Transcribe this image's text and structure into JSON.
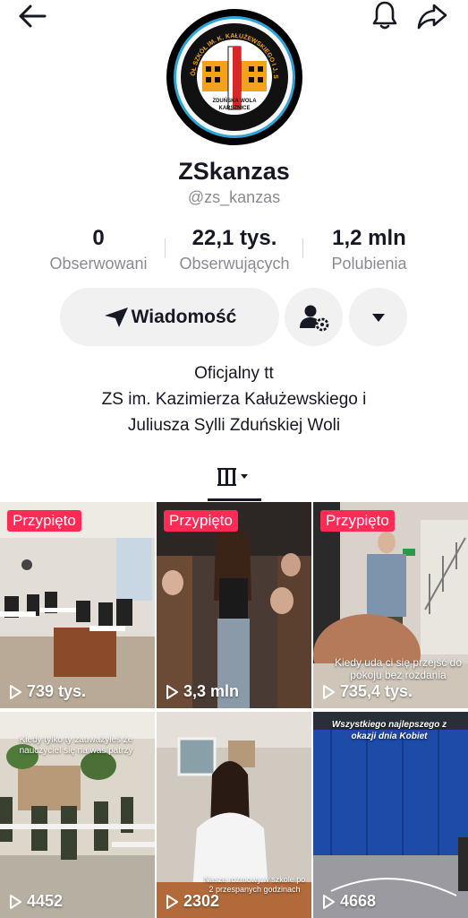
{
  "header": {
    "back_icon": "arrow-left-icon",
    "bell_icon": "bell-icon",
    "share_icon": "share-arrow-icon"
  },
  "profile": {
    "logo_text_top": "ZESPÓŁ SZKÓŁ IM. K. KAŁUŻEWSKIEGO I J. SYLLI",
    "logo_text_bottom_1": "ZDUŃSKA WOLA",
    "logo_text_bottom_2": "KARSZNICE",
    "name": "ZSkanzas",
    "handle": "@zs_kanzas"
  },
  "stats": [
    {
      "value": "0",
      "label": "Obserwowani"
    },
    {
      "value": "22,1 tys.",
      "label": "Obserwujących"
    },
    {
      "value": "1,2 mln",
      "label": "Polubienia"
    }
  ],
  "actions": {
    "message_label": "Wiadomość",
    "message_icon": "send-icon",
    "friend_settings_icon": "user-gear-icon",
    "more_icon": "caret-down-icon"
  },
  "bio": {
    "line1": "Oficjalny tt",
    "line2": "ZS im. Kazimierza Kałużewskiego i",
    "line3": "Juliusza Sylli Zduńskiej Woli"
  },
  "tabs": {
    "videos_icon": "grid-bars-icon"
  },
  "videos": [
    {
      "pinned": "Przypięto",
      "views": "739 tys.",
      "caption": ""
    },
    {
      "pinned": "Przypięto",
      "views": "3,3 mln",
      "caption": ""
    },
    {
      "pinned": "Przypięto",
      "views": "735,4 tys.",
      "caption": "Kiedy uda ci się przejść do pokoju bez rozdania"
    },
    {
      "pinned": "",
      "views": "4452",
      "caption": "Kiedy tylko ty zauważyłeś że nauczyciel się na was patrzy"
    },
    {
      "pinned": "",
      "views": "2302",
      "caption": "Nasze rozmowy w szkole po 2 przespanych godzinach"
    },
    {
      "pinned": "",
      "views": "4668",
      "caption": "Wszystkiego najlepszego z okazji dnia Kobiet"
    }
  ],
  "colors": {
    "accent": "#fe2c55",
    "secondary_text": "#8a8b91",
    "button_bg": "#f1f1f2"
  }
}
